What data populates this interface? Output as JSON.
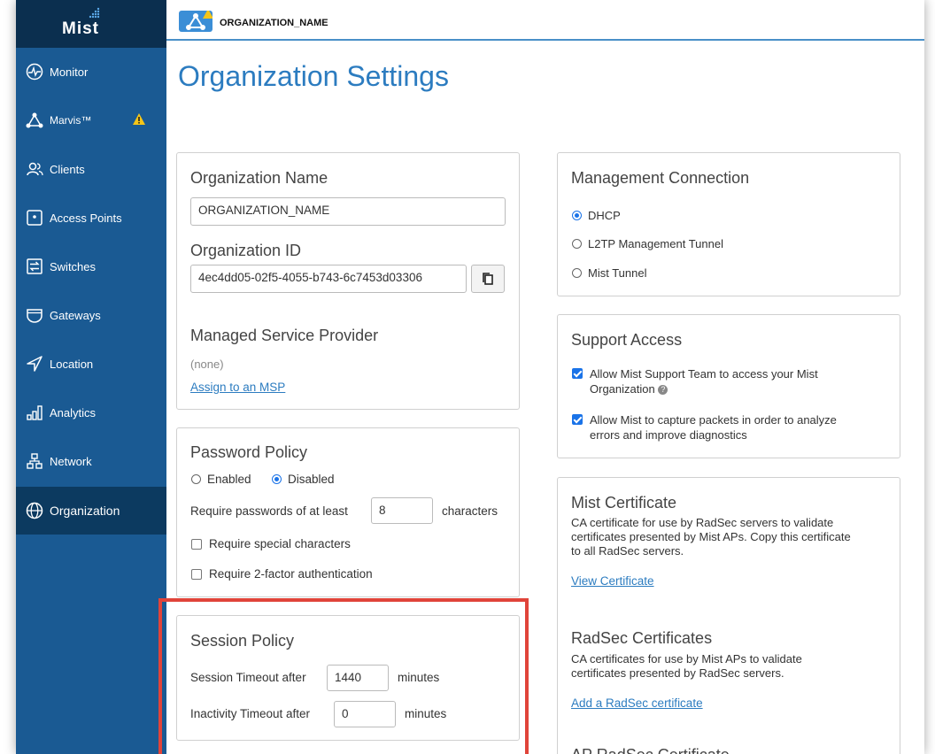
{
  "app": {
    "logo": "Mist",
    "org_name": "ORGANIZATION_NAME"
  },
  "sidebar": {
    "items": [
      {
        "label": "Monitor",
        "icon": "monitor-icon"
      },
      {
        "label": "Marvis™",
        "icon": "marvis-icon",
        "warning": true
      },
      {
        "label": "Clients",
        "icon": "clients-icon"
      },
      {
        "label": "Access Points",
        "icon": "access-point-icon"
      },
      {
        "label": "Switches",
        "icon": "switch-icon"
      },
      {
        "label": "Gateways",
        "icon": "gateway-icon"
      },
      {
        "label": "Location",
        "icon": "location-icon"
      },
      {
        "label": "Analytics",
        "icon": "analytics-icon"
      },
      {
        "label": "Network",
        "icon": "network-icon"
      },
      {
        "label": "Organization",
        "icon": "organization-icon",
        "active": true
      }
    ]
  },
  "page": {
    "title": "Organization Settings"
  },
  "org_info": {
    "name_title": "Organization Name",
    "name_value": "ORGANIZATION_NAME",
    "id_title": "Organization ID",
    "id_value": "4ec4dd05-02f5-4055-b743-6c7453d03306",
    "msp_title": "Managed Service Provider",
    "msp_value": "(none)",
    "msp_link": "Assign to an MSP"
  },
  "password_policy": {
    "title": "Password Policy",
    "enabled_label": "Enabled",
    "disabled_label": "Disabled",
    "selected": "Disabled",
    "min_length_prefix": "Require passwords of at least",
    "min_length_value": "8",
    "min_length_suffix": "characters",
    "special_chars_label": "Require special characters",
    "two_factor_label": "Require 2-factor authentication"
  },
  "session_policy": {
    "title": "Session Policy",
    "timeout_label": "Session Timeout after",
    "timeout_value": "1440",
    "timeout_unit": "minutes",
    "inactivity_label": "Inactivity Timeout after",
    "inactivity_value": "0",
    "inactivity_unit": "minutes"
  },
  "management_connection": {
    "title": "Management Connection",
    "options": [
      "DHCP",
      "L2TP Management Tunnel",
      "Mist Tunnel"
    ],
    "selected": "DHCP"
  },
  "support_access": {
    "title": "Support Access",
    "option1_line1": "Allow Mist Support Team to access your Mist",
    "option1_line2": "Organization",
    "option2_line1": "Allow Mist to capture packets in order to analyze",
    "option2_line2": "errors and improve diagnostics"
  },
  "mist_certificate": {
    "title": "Mist Certificate",
    "desc_line1": "CA certificate for use by RadSec servers to validate",
    "desc_line2": "certificates presented by Mist APs. Copy this certificate",
    "desc_line3": "to all RadSec servers.",
    "link": "View Certificate"
  },
  "radsec": {
    "title": "RadSec Certificates",
    "desc_line1": "CA certificates for use by Mist APs to validate",
    "desc_line2": "certificates presented by RadSec servers.",
    "link": "Add a RadSec certificate",
    "next_title_partial": "AP RadSec Certificate"
  }
}
